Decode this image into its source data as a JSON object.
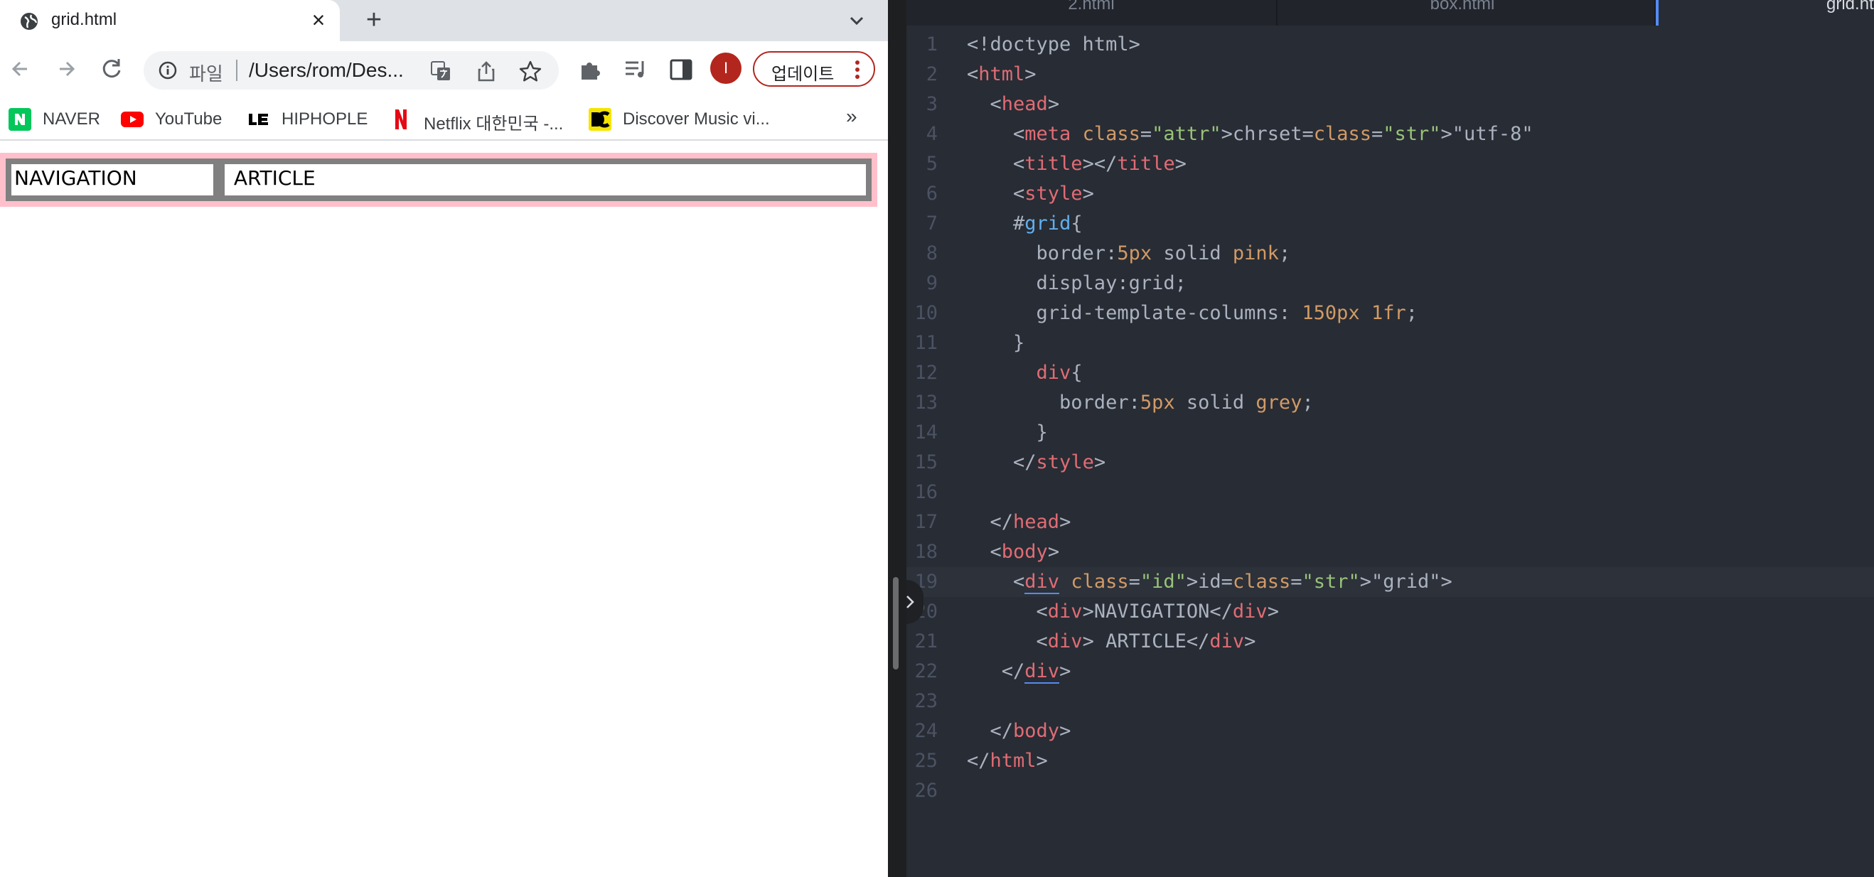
{
  "browser": {
    "tab": {
      "title": "grid.html",
      "close_icon": "close-icon"
    },
    "new_tab_label": "+",
    "omnibox": {
      "scheme": "파일",
      "url": "/Users/rom/Des..."
    },
    "update_button_label": "업데이트",
    "avatar_initial": "I",
    "bookmarks": [
      {
        "label": "NAVER",
        "favicon": "naver-icon",
        "color": "#03c75a"
      },
      {
        "label": "YouTube",
        "favicon": "youtube-icon",
        "color": "#ff0000"
      },
      {
        "label": "HIPHOPLE",
        "favicon": "hiphople-icon",
        "color": "#000000"
      },
      {
        "label": "Netflix 대한민국 -...",
        "favicon": "netflix-icon",
        "color": "#e50914"
      },
      {
        "label": "Discover Music vi...",
        "favicon": "discogs-icon",
        "color": "#f5e400"
      }
    ],
    "bookmarks_more": "»",
    "page": {
      "cells": [
        "NAVIGATION",
        " ARTICLE"
      ],
      "grid_border_color": "pink",
      "cell_border_color": "grey"
    }
  },
  "editor": {
    "tabs": [
      "2.html",
      "box.html",
      "grid.html"
    ],
    "active_tab": "grid.html",
    "current_line": 19,
    "lines": [
      "<!doctype html>",
      "<html>",
      "  <head>",
      "    <meta chrset=\"utf-8\"",
      "    <title></title>",
      "    <style>",
      "    #grid{",
      "      border:5px solid pink;",
      "      display:grid;",
      "      grid-template-columns: 150px 1fr;",
      "    }",
      "      div{",
      "        border:5px solid grey;",
      "      }",
      "    </style>",
      "",
      "  </head>",
      "  <body>",
      "    <div id=\"grid\">",
      "      <div>NAVIGATION</div>",
      "      <div> ARTICLE</div>",
      "   </div>",
      "",
      "  </body>",
      "</html>",
      ""
    ]
  }
}
